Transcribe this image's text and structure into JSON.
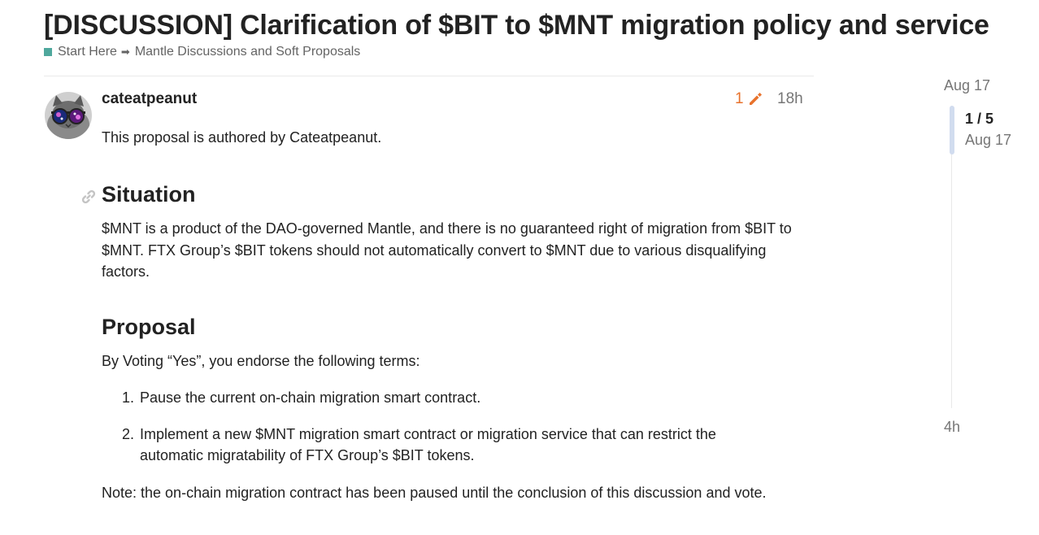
{
  "topic": {
    "title": "[DISCUSSION] Clarification of $BIT to $MNT migration policy and service"
  },
  "breadcrumb": {
    "category": "Start Here",
    "separator": "➡",
    "subcategory": "Mantle Discussions and Soft Proposals",
    "category_color": "#4fa89d"
  },
  "post": {
    "username": "cateatpeanut",
    "edit_count": "1",
    "age": "18h",
    "intro": "This proposal is authored by Cateatpeanut.",
    "situation_heading": "Situation",
    "situation_text": "$MNT is a product of the DAO-governed Mantle, and there is no guaranteed right of migration from $BIT to $MNT. FTX Group’s $BIT tokens should not automatically convert to $MNT due to various disqualifying factors.",
    "proposal_heading": "Proposal",
    "proposal_intro": "By Voting “Yes”, you endorse the following terms:",
    "terms": [
      {
        "num": "1.",
        "text": "Pause the current on-chain migration smart contract."
      },
      {
        "num": "2.",
        "text": "Implement a new $MNT migration smart contract or migration service that can restrict the automatic migratability of FTX Group’s $BIT tokens."
      }
    ],
    "note": "Note: the on-chain migration contract has been paused until the conclusion of this discussion and vote.",
    "edit_color": "#e8722c"
  },
  "timeline": {
    "start_date": "Aug 17",
    "position": "1 / 5",
    "position_date": "Aug 17",
    "end_label": "4h"
  }
}
